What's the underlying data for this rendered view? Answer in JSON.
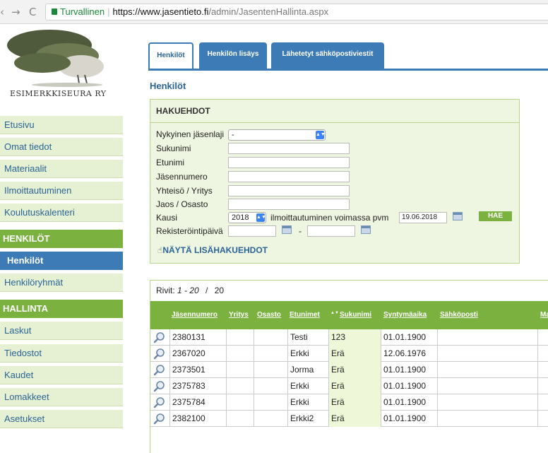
{
  "browser": {
    "back": "‹",
    "forward": "→",
    "reload": "C",
    "secure_label": "Turvallinen",
    "url_host": "https://www.jasentieto.fi",
    "url_path": "/admin/JasentenHallinta.aspx"
  },
  "org": {
    "name": "ESIMERKKISEURA RY"
  },
  "sidebar": {
    "items": [
      {
        "label": "Etusivu"
      },
      {
        "label": "Omat tiedot"
      },
      {
        "label": "Materiaalit"
      },
      {
        "label": "Ilmoittautuminen"
      },
      {
        "label": "Koulutuskalenteri"
      }
    ],
    "section_persons": "HENKILÖT",
    "persons_items": [
      {
        "label": "Henkilöt"
      },
      {
        "label": "Henkilöryhmät"
      }
    ],
    "section_admin": "HALLINTA",
    "admin_items": [
      {
        "label": "Laskut"
      },
      {
        "label": "Tiedostot"
      },
      {
        "label": "Kaudet"
      },
      {
        "label": "Lomakkeet"
      },
      {
        "label": "Asetukset"
      }
    ]
  },
  "tabs": [
    {
      "label": "Henkilöt"
    },
    {
      "label": "Henkilön lisäys"
    },
    {
      "label": "Lähetetyt sähköpostiviestit"
    }
  ],
  "page_title": "Henkilöt",
  "search": {
    "heading": "HAKUEHDOT",
    "labels": {
      "membership_type": "Nykyinen jäsenlaji",
      "last_name": "Sukunimi",
      "first_name": "Etunimi",
      "member_number": "Jäsennumero",
      "organization": "Yhteisö / Yritys",
      "division": "Jaos / Osasto",
      "season": "Kausi",
      "registration_valid": "ilmoittautuminen voimassa pvm",
      "registration_date": "Rekisteröintipäivä",
      "date_separator": "-"
    },
    "values": {
      "membership_type": "-",
      "season": "2018",
      "registration_valid_date": "19.06.2018"
    },
    "submit_label": "HAE",
    "more_criteria_label": "NÄYTÄ LISÄHAKUEHDOT"
  },
  "results": {
    "rows_label": "Rivit:",
    "rows_range": "1 - 20",
    "rows_sep": "/",
    "rows_total": "20",
    "columns": [
      "Jäsennumero",
      "Yritys",
      "Osasto",
      "Etunimet",
      "Sukunimi",
      "Syntymäaika",
      "Sähköposti",
      "Ma"
    ],
    "sort_indicator": "▲▼",
    "rows": [
      {
        "number": "2380131",
        "company": "",
        "division": "",
        "first": "Testi",
        "last": "123",
        "birth": "01.01.1900",
        "email": ""
      },
      {
        "number": "2367020",
        "company": "",
        "division": "",
        "first": "Erkki",
        "last": "Erä",
        "birth": "12.06.1976",
        "email": ""
      },
      {
        "number": "2373501",
        "company": "",
        "division": "",
        "first": "Jorma",
        "last": "Erä",
        "birth": "01.01.1900",
        "email": ""
      },
      {
        "number": "2375783",
        "company": "",
        "division": "",
        "first": "Erkki",
        "last": "Erä",
        "birth": "01.01.1900",
        "email": ""
      },
      {
        "number": "2375784",
        "company": "",
        "division": "",
        "first": "Erkki",
        "last": "Erä",
        "birth": "01.01.1900",
        "email": ""
      },
      {
        "number": "2382100",
        "company": "",
        "division": "",
        "first": "Erkki2",
        "last": "Erä",
        "birth": "01.01.1900",
        "email": ""
      }
    ]
  },
  "colors": {
    "accent_blue": "#3c7bb5",
    "accent_green": "#7bb23f",
    "panel_bg": "#eef5e0"
  }
}
